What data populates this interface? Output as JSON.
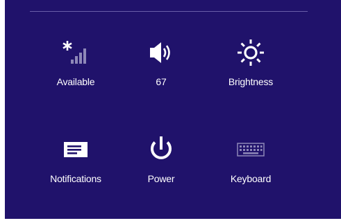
{
  "colors": {
    "panel_background": "#20126b",
    "foreground": "#ffffff",
    "divider": "#6a5fa8",
    "dim_bar": "#8e88b8"
  },
  "settings": {
    "network": {
      "label": "Available",
      "icon": "network-signal-icon"
    },
    "volume": {
      "label": "67",
      "icon": "speaker-icon"
    },
    "brightness": {
      "label": "Brightness",
      "icon": "brightness-icon"
    },
    "notifications": {
      "label": "Notifications",
      "icon": "notifications-icon"
    },
    "power": {
      "label": "Power",
      "icon": "power-icon"
    },
    "keyboard": {
      "label": "Keyboard",
      "icon": "keyboard-icon"
    }
  }
}
